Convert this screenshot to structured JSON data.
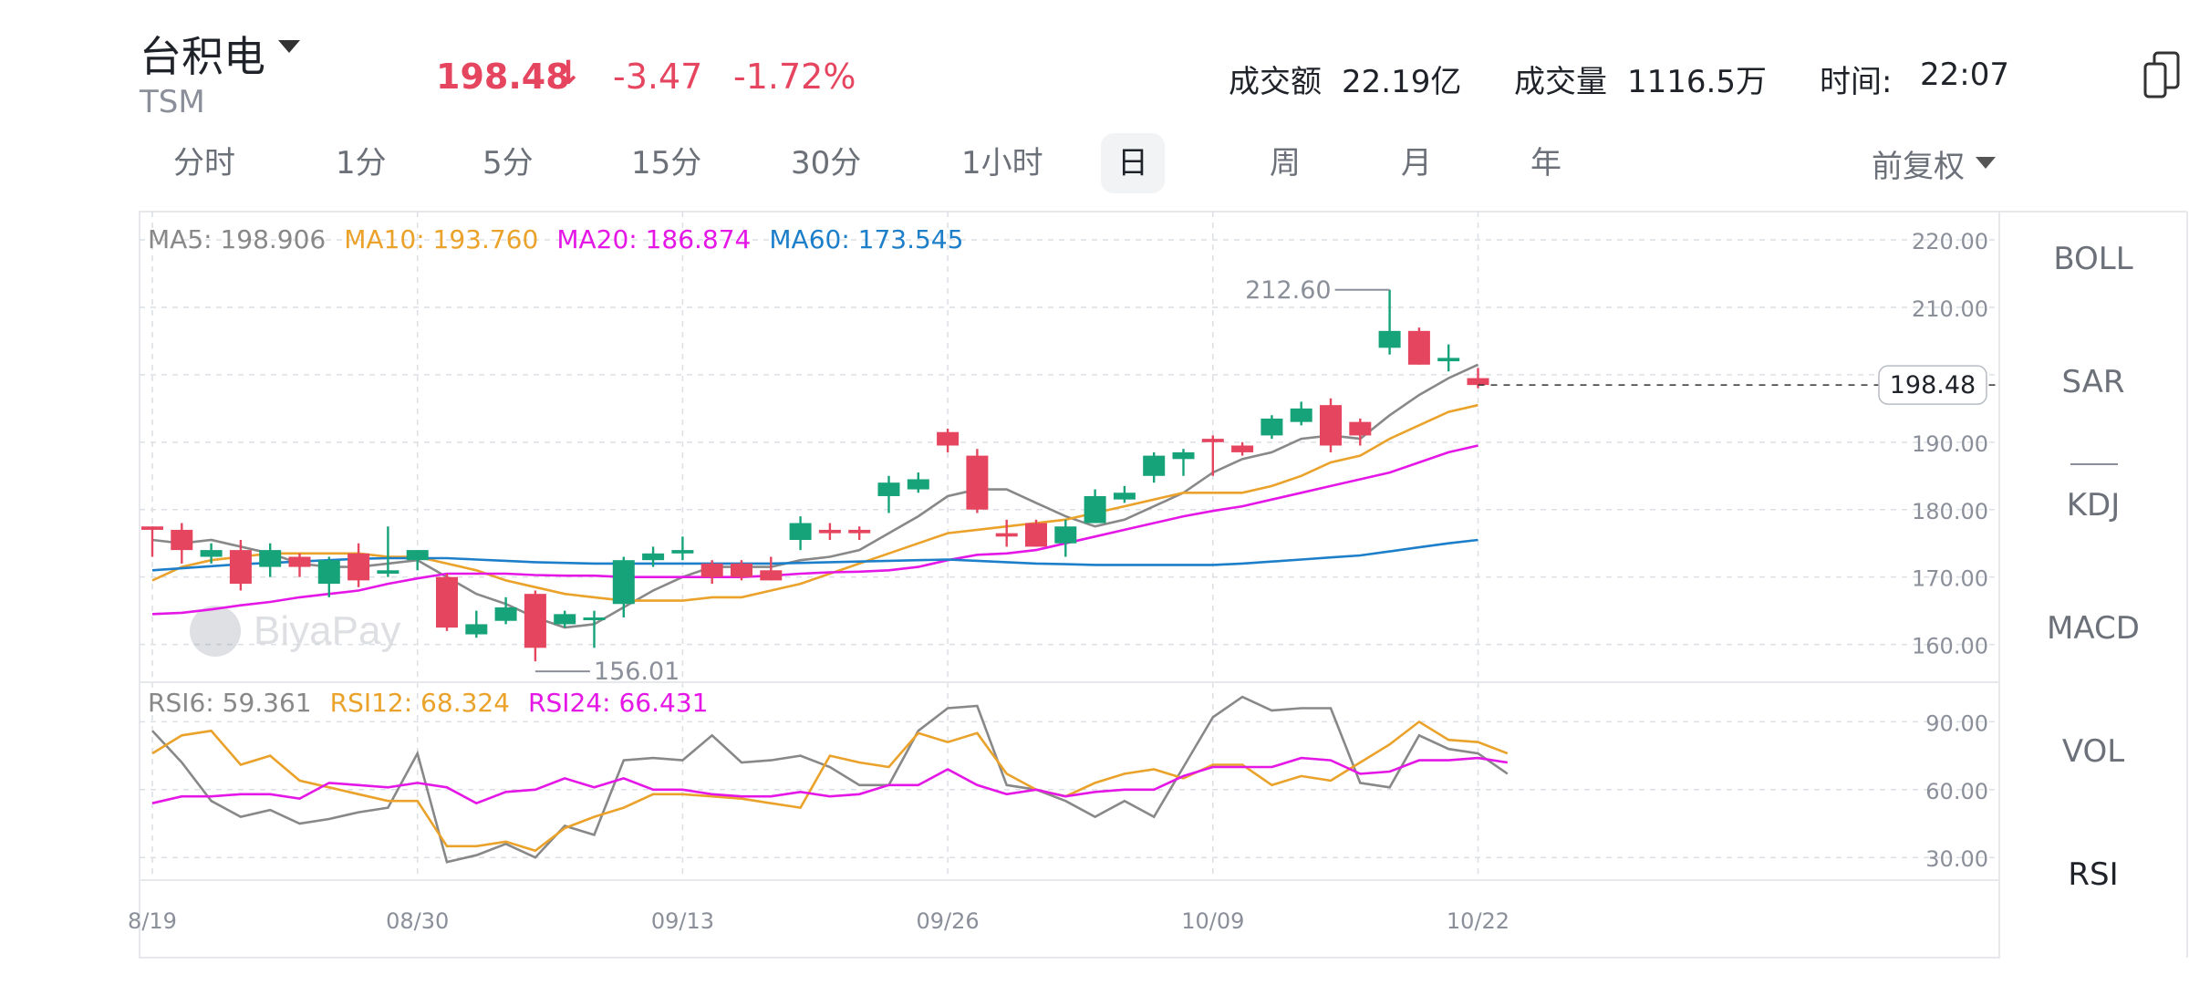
{
  "header": {
    "name": "台积电",
    "code": "TSM",
    "price": "198.48",
    "price_arrow": "↓",
    "change": "-3.47",
    "change_pct": "-1.72%",
    "turnover_label": "成交额",
    "turnover": "22.19亿",
    "volume_label": "成交量",
    "volume": "1116.5万",
    "time_label": "时间:",
    "time": "22:07"
  },
  "tabs": [
    "分时",
    "1分",
    "5分",
    "15分",
    "30分",
    "1小时",
    "日",
    "周",
    "月",
    "年"
  ],
  "active_tab": "日",
  "adjust_label": "前复权",
  "indicators": [
    "BOLL",
    "SAR",
    "KDJ",
    "MACD",
    "VOL",
    "RSI"
  ],
  "active_indicator": "RSI",
  "watermark": "BiyaPay",
  "colors": {
    "up": "#16a37a",
    "down": "#e6455f",
    "ma5": "#888888",
    "ma10": "#eaa22a",
    "ma20": "#e417e6",
    "ma60": "#1d7fc9",
    "rsi6": "#888888",
    "rsi12": "#eaa22a",
    "rsi24": "#e417e6"
  },
  "chart_data": [
    {
      "type": "candlestick",
      "title": "",
      "y_ticks": [
        "220.00",
        "210.00",
        "200.00",
        "190.00",
        "180.00",
        "170.00",
        "160.00"
      ],
      "ylim": [
        154.4,
        224.2
      ],
      "x_tick_labels": [
        "8/19",
        "08/30",
        "09/13",
        "09/26",
        "10/09",
        "10/22"
      ],
      "x_tick_index": [
        0,
        9,
        18,
        27,
        36,
        45
      ],
      "last_price_label": "198.48",
      "high_annotation": "212.60",
      "low_annotation": "156.01",
      "candles": [
        {
          "o": 177.5,
          "h": 177.5,
          "l": 173.0,
          "c": 177.0
        },
        {
          "o": 177.0,
          "h": 178.0,
          "l": 172.0,
          "c": 174.0
        },
        {
          "o": 173.0,
          "h": 175.0,
          "l": 172.0,
          "c": 174.0
        },
        {
          "o": 174.0,
          "h": 175.5,
          "l": 168.0,
          "c": 169.0
        },
        {
          "o": 171.5,
          "h": 175.0,
          "l": 170.0,
          "c": 174.0
        },
        {
          "o": 173.0,
          "h": 173.5,
          "l": 170.0,
          "c": 171.5
        },
        {
          "o": 169.0,
          "h": 173.0,
          "l": 167.0,
          "c": 172.5
        },
        {
          "o": 173.5,
          "h": 175.0,
          "l": 168.5,
          "c": 169.5
        },
        {
          "o": 170.5,
          "h": 177.5,
          "l": 170.0,
          "c": 171.0
        },
        {
          "o": 172.5,
          "h": 174.0,
          "l": 171.0,
          "c": 174.0
        },
        {
          "o": 170.0,
          "h": 170.5,
          "l": 162.0,
          "c": 162.5
        },
        {
          "o": 161.5,
          "h": 165.0,
          "l": 161.0,
          "c": 163.0
        },
        {
          "o": 163.5,
          "h": 167.0,
          "l": 163.0,
          "c": 165.5
        },
        {
          "o": 167.5,
          "h": 168.0,
          "l": 157.5,
          "c": 159.5
        },
        {
          "o": 163.0,
          "h": 165.0,
          "l": 162.5,
          "c": 164.5
        },
        {
          "o": 164.0,
          "h": 165.0,
          "l": 159.5,
          "c": 164.0
        },
        {
          "o": 166.0,
          "h": 173.0,
          "l": 164.0,
          "c": 172.5
        },
        {
          "o": 172.5,
          "h": 174.5,
          "l": 171.5,
          "c": 173.5
        },
        {
          "o": 173.5,
          "h": 176.0,
          "l": 172.5,
          "c": 174.0
        },
        {
          "o": 172.0,
          "h": 172.5,
          "l": 169.0,
          "c": 170.0
        },
        {
          "o": 172.0,
          "h": 172.5,
          "l": 169.5,
          "c": 170.0
        },
        {
          "o": 171.0,
          "h": 173.0,
          "l": 169.5,
          "c": 169.5
        },
        {
          "o": 175.5,
          "h": 179.0,
          "l": 174.0,
          "c": 178.0
        },
        {
          "o": 177.0,
          "h": 178.0,
          "l": 175.5,
          "c": 176.5
        },
        {
          "o": 177.0,
          "h": 177.5,
          "l": 175.5,
          "c": 176.5
        },
        {
          "o": 182.0,
          "h": 185.0,
          "l": 179.5,
          "c": 184.0
        },
        {
          "o": 183.0,
          "h": 185.5,
          "l": 182.5,
          "c": 184.5
        },
        {
          "o": 191.5,
          "h": 192.0,
          "l": 188.5,
          "c": 189.5
        },
        {
          "o": 188.0,
          "h": 189.0,
          "l": 179.5,
          "c": 180.0
        },
        {
          "o": 176.5,
          "h": 178.5,
          "l": 174.5,
          "c": 176.0
        },
        {
          "o": 178.0,
          "h": 178.5,
          "l": 174.5,
          "c": 174.5
        },
        {
          "o": 175.0,
          "h": 178.5,
          "l": 173.0,
          "c": 177.5
        },
        {
          "o": 178.0,
          "h": 183.0,
          "l": 178.0,
          "c": 182.0
        },
        {
          "o": 181.5,
          "h": 183.5,
          "l": 181.0,
          "c": 182.5
        },
        {
          "o": 185.0,
          "h": 188.5,
          "l": 184.0,
          "c": 188.0
        },
        {
          "o": 187.5,
          "h": 189.0,
          "l": 185.0,
          "c": 188.5
        },
        {
          "o": 190.5,
          "h": 191.0,
          "l": 185.0,
          "c": 190.0
        },
        {
          "o": 189.5,
          "h": 190.0,
          "l": 188.0,
          "c": 188.5
        },
        {
          "o": 191.0,
          "h": 194.0,
          "l": 190.5,
          "c": 193.5
        },
        {
          "o": 193.0,
          "h": 196.0,
          "l": 192.5,
          "c": 195.0
        },
        {
          "o": 195.5,
          "h": 196.5,
          "l": 188.5,
          "c": 189.5
        },
        {
          "o": 193.0,
          "h": 193.5,
          "l": 189.5,
          "c": 191.0
        },
        {
          "o": 204.0,
          "h": 212.6,
          "l": 203.0,
          "c": 206.5
        },
        {
          "o": 206.5,
          "h": 207.0,
          "l": 201.5,
          "c": 201.5
        },
        {
          "o": 202.0,
          "h": 204.5,
          "l": 200.5,
          "c": 202.5
        },
        {
          "o": 199.5,
          "h": 201.0,
          "l": 198.0,
          "c": 198.48
        }
      ],
      "ma_legend": [
        {
          "name": "MA5",
          "value": "198.906",
          "color_key": "ma5"
        },
        {
          "name": "MA10",
          "value": "193.760",
          "color_key": "ma10"
        },
        {
          "name": "MA20",
          "value": "186.874",
          "color_key": "ma20"
        },
        {
          "name": "MA60",
          "value": "173.545",
          "color_key": "ma60"
        }
      ],
      "series": [
        {
          "name": "MA5",
          "color_key": "ma5",
          "values": [
            175.5,
            175.0,
            175.5,
            174.5,
            173.5,
            172.0,
            171.5,
            171.5,
            172.0,
            172.5,
            170.0,
            167.5,
            166.0,
            164.0,
            162.5,
            163.0,
            165.5,
            168.0,
            170.0,
            171.5,
            171.5,
            171.5,
            172.5,
            173.0,
            174.0,
            176.5,
            179.0,
            182.0,
            183.0,
            183.0,
            181.0,
            179.0,
            177.5,
            178.5,
            180.5,
            182.5,
            185.5,
            187.5,
            188.5,
            190.5,
            191.0,
            190.5,
            194.0,
            197.0,
            199.5,
            201.5
          ]
        },
        {
          "name": "MA10",
          "color_key": "ma10",
          "values": [
            169.5,
            171.5,
            172.5,
            173.0,
            173.5,
            173.5,
            173.5,
            173.5,
            173.0,
            173.0,
            172.0,
            171.0,
            169.5,
            168.5,
            167.5,
            167.0,
            166.5,
            166.5,
            166.5,
            167.0,
            167.0,
            168.0,
            169.0,
            170.5,
            172.0,
            173.5,
            175.0,
            176.5,
            177.0,
            177.5,
            178.0,
            178.5,
            179.5,
            180.5,
            181.5,
            182.5,
            182.5,
            182.5,
            183.5,
            185.0,
            187.0,
            188.0,
            190.5,
            192.5,
            194.5,
            195.5
          ]
        },
        {
          "name": "MA20",
          "color_key": "ma20",
          "values": [
            164.5,
            164.7,
            165.2,
            165.8,
            166.3,
            167.0,
            167.5,
            168.0,
            169.0,
            169.8,
            170.5,
            170.5,
            170.5,
            170.3,
            170.2,
            170.2,
            170.0,
            170.0,
            170.0,
            170.0,
            170.0,
            170.2,
            170.5,
            170.7,
            170.8,
            171.0,
            171.5,
            172.5,
            173.3,
            173.5,
            174.0,
            175.0,
            176.0,
            177.0,
            178.0,
            179.0,
            179.8,
            180.5,
            181.5,
            182.5,
            183.5,
            184.5,
            185.5,
            187.0,
            188.5,
            189.5
          ]
        },
        {
          "name": "MA60",
          "color_key": "ma60",
          "values": [
            171.0,
            171.3,
            171.6,
            171.9,
            172.1,
            172.3,
            172.5,
            172.7,
            172.8,
            172.8,
            172.8,
            172.6,
            172.4,
            172.2,
            172.1,
            172.0,
            172.0,
            172.0,
            172.0,
            172.0,
            172.0,
            172.0,
            172.1,
            172.2,
            172.3,
            172.4,
            172.5,
            172.6,
            172.4,
            172.2,
            172.0,
            171.9,
            171.8,
            171.8,
            171.8,
            171.8,
            171.8,
            172.0,
            172.3,
            172.6,
            172.9,
            173.2,
            173.8,
            174.4,
            175.0,
            175.5
          ]
        }
      ]
    },
    {
      "type": "line",
      "title": "",
      "y_ticks": [
        "90.00",
        "60.00",
        "30.00"
      ],
      "ylim": [
        20.0,
        107.5
      ],
      "rsi_legend": [
        {
          "name": "RSI6",
          "value": "59.361",
          "color_key": "rsi6"
        },
        {
          "name": "RSI12",
          "value": "68.324",
          "color_key": "rsi12"
        },
        {
          "name": "RSI24",
          "value": "66.431",
          "color_key": "rsi24"
        }
      ],
      "series": [
        {
          "name": "RSI6",
          "color_key": "rsi6",
          "values": [
            86,
            72,
            55,
            48,
            51,
            45,
            47,
            50,
            52,
            76,
            28,
            31,
            36,
            30,
            44,
            40,
            73,
            74,
            73,
            84,
            72,
            73,
            75,
            70,
            62,
            62,
            86,
            96,
            97,
            62,
            60,
            55,
            48,
            55,
            48,
            70,
            92,
            101,
            95,
            96,
            96,
            63,
            61,
            84,
            78,
            76,
            67
          ]
        },
        {
          "name": "RSI12",
          "color_key": "rsi12",
          "values": [
            76,
            84,
            86,
            71,
            75,
            64,
            61,
            58,
            55,
            55,
            35,
            35,
            37,
            33,
            43,
            48,
            52,
            58,
            58,
            57,
            56,
            54,
            52,
            75,
            72,
            70,
            85,
            81,
            85,
            67,
            60,
            57,
            63,
            67,
            69,
            65,
            71,
            71,
            62,
            66,
            64,
            72,
            80,
            90,
            82,
            81,
            76
          ]
        },
        {
          "name": "RSI24",
          "color_key": "rsi24",
          "values": [
            54,
            57,
            57,
            58,
            58,
            56,
            63,
            62,
            61,
            63,
            61,
            54,
            59,
            60,
            65,
            61,
            65,
            60,
            60,
            58,
            57,
            57,
            59,
            57,
            58,
            62,
            62,
            69,
            62,
            58,
            60,
            57,
            59,
            60,
            60,
            66,
            70,
            70,
            70,
            74,
            73,
            67,
            68,
            73,
            73,
            74,
            72
          ]
        }
      ]
    }
  ]
}
